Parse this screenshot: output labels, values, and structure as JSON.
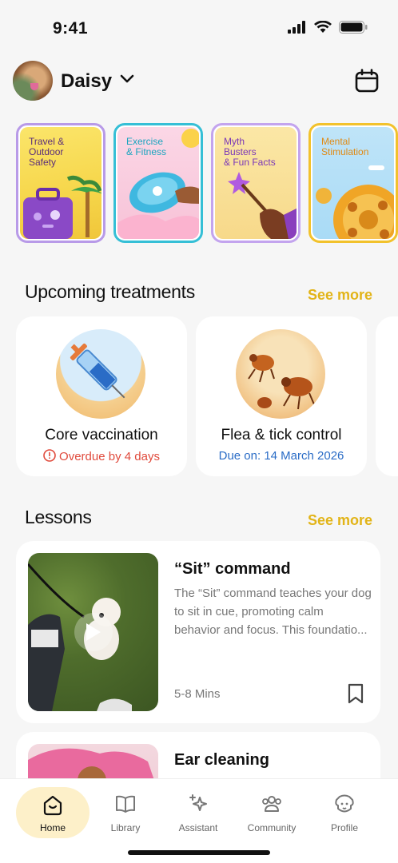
{
  "status": {
    "time": "9:41"
  },
  "header": {
    "pet_name": "Daisy"
  },
  "stories": [
    {
      "label": "Travel &\nOutdoor\nSafety",
      "color": "#b89ae8"
    },
    {
      "label": "Exercise\n& Fitness",
      "color": "#35bfd6"
    },
    {
      "label": "Myth\nBusters\n& Fun Facts",
      "color": "#c3a4ee"
    },
    {
      "label": "Mental\nStimulation",
      "color": "#f2c22c"
    }
  ],
  "treatments": {
    "title": "Upcoming treatments",
    "see_more": "See more",
    "items": [
      {
        "name": "Core vaccination",
        "status": "Overdue by 4 days",
        "status_color": "#e04a3c"
      },
      {
        "name": "Flea & tick control",
        "status": "Due on: 14 March 2026",
        "status_color": "#2a6cc6"
      }
    ]
  },
  "lessons": {
    "title": "Lessons",
    "see_more": "See more",
    "items": [
      {
        "title": "“Sit” command",
        "description": "The “Sit” command teaches your dog to sit in cue, promoting calm behavior and focus. This foundatio...",
        "duration": "5-8 Mins"
      },
      {
        "title": "Ear cleaning",
        "description": "",
        "duration": ""
      }
    ]
  },
  "tabs": [
    {
      "label": "Home",
      "active": true
    },
    {
      "label": "Library",
      "active": false
    },
    {
      "label": "Assistant",
      "active": false
    },
    {
      "label": "Community",
      "active": false
    },
    {
      "label": "Profile",
      "active": false
    }
  ],
  "colors": {
    "accent": "#e2b418",
    "active_tab": "#fdf0c9"
  }
}
